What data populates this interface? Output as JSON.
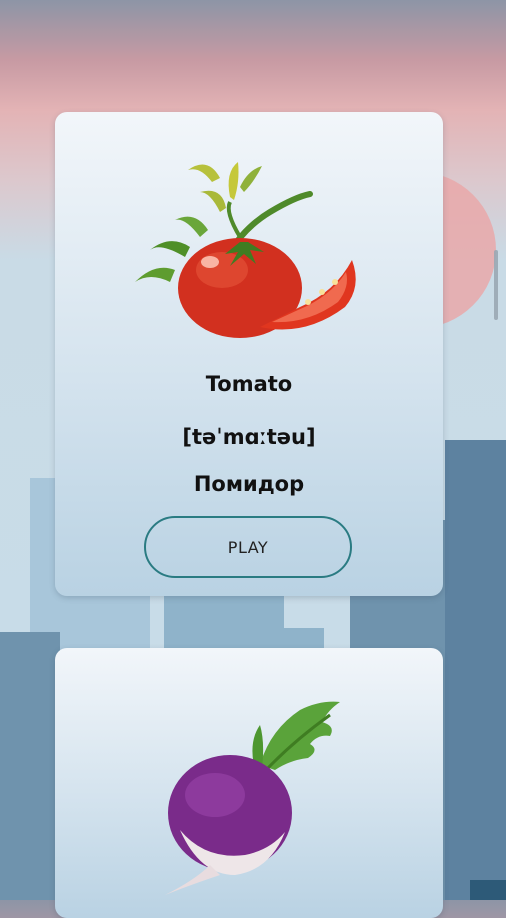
{
  "cards": [
    {
      "word": "Tomato",
      "transcription": "[təˈmɑːtəu]",
      "translation": "Помидор",
      "play_label": "PLAY",
      "image": "tomato-illustration"
    },
    {
      "image": "radish-illustration"
    }
  ],
  "colors": {
    "accent": "#2a7b82",
    "card_top": "#f2f6fa",
    "card_bottom": "#b9d2e3",
    "city": "#6f93ad",
    "sun": "#e8a7a8"
  }
}
